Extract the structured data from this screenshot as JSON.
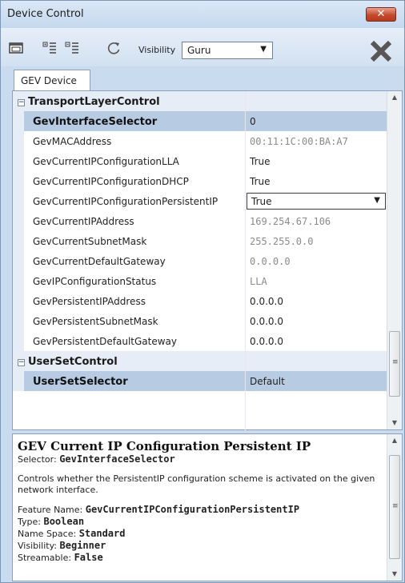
{
  "window": {
    "title": "Device Control",
    "close_label": "✕"
  },
  "toolbar": {
    "visibility_label": "Visibility",
    "visibility_value": "Guru",
    "icons": [
      "window-icon",
      "expand-all-icon",
      "collapse-all-icon",
      "refresh-icon",
      "clear-icon"
    ]
  },
  "tabs": [
    {
      "label": "GEV Device",
      "active": true
    }
  ],
  "grid": {
    "groups": [
      {
        "name": "TransportLayerControl",
        "expanded": true,
        "rows": [
          {
            "name": "GevInterfaceSelector",
            "value": "0",
            "selected": true,
            "readonly": false
          },
          {
            "name": "GevMACAddress",
            "value": "00:11:1C:00:BA:A7",
            "readonly": true
          },
          {
            "name": "GevCurrentIPConfigurationLLA",
            "value": "True",
            "readonly": false
          },
          {
            "name": "GevCurrentIPConfigurationDHCP",
            "value": "True",
            "readonly": false
          },
          {
            "name": "GevCurrentIPConfigurationPersistentIP",
            "value": "True",
            "readonly": false,
            "editing": true
          },
          {
            "name": "GevCurrentIPAddress",
            "value": "169.254.67.106",
            "readonly": true
          },
          {
            "name": "GevCurrentSubnetMask",
            "value": "255.255.0.0",
            "readonly": true
          },
          {
            "name": "GevCurrentDefaultGateway",
            "value": "0.0.0.0",
            "readonly": true
          },
          {
            "name": "GevIPConfigurationStatus",
            "value": "LLA",
            "readonly": true
          },
          {
            "name": "GevPersistentIPAddress",
            "value": "0.0.0.0",
            "readonly": false
          },
          {
            "name": "GevPersistentSubnetMask",
            "value": "0.0.0.0",
            "readonly": false
          },
          {
            "name": "GevPersistentDefaultGateway",
            "value": "0.0.0.0",
            "readonly": false
          }
        ]
      },
      {
        "name": "UserSetControl",
        "expanded": true,
        "rows": [
          {
            "name": "UserSetSelector",
            "value": "Default",
            "selected": true,
            "readonly": false
          }
        ]
      }
    ]
  },
  "description": {
    "title": "GEV Current IP Configuration Persistent IP",
    "selector_label": "Selector:",
    "selector_value": "GevInterfaceSelector",
    "text": "Controls whether the PersistentIP configuration scheme is activated on the given network interface.",
    "feature_name_label": "Feature Name:",
    "feature_name_value": "GevCurrentIPConfigurationPersistentIP",
    "type_label": "Type:",
    "type_value": "Boolean",
    "name_space_label": "Name Space:",
    "name_space_value": "Standard",
    "visibility_label": "Visibility:",
    "visibility_value": "Beginner",
    "streamable_label": "Streamable:",
    "streamable_value": "False"
  }
}
